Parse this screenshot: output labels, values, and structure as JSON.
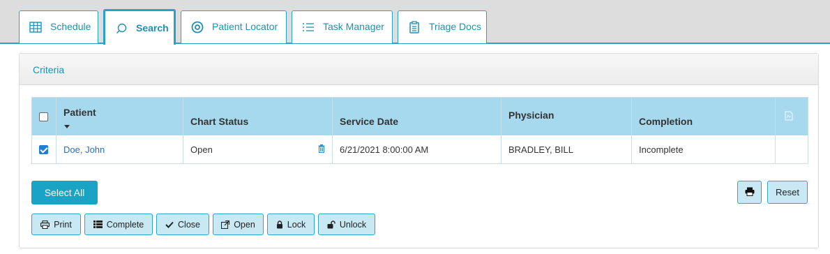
{
  "tabs": [
    {
      "label": "Schedule",
      "icon": "grid-icon",
      "active": false
    },
    {
      "label": "Search",
      "icon": "search-icon",
      "active": true
    },
    {
      "label": "Patient Locator",
      "icon": "target-icon",
      "active": false
    },
    {
      "label": "Task Manager",
      "icon": "list-icon",
      "active": false
    },
    {
      "label": "Triage Docs",
      "icon": "clipboard-icon",
      "active": false
    }
  ],
  "panel": {
    "title": "Criteria"
  },
  "table": {
    "columns": [
      "Patient",
      "Chart Status",
      "Service Date",
      "Physician",
      "Completion"
    ],
    "rows": [
      {
        "checked": true,
        "patient": "Doe, John",
        "chart_status": "Open",
        "service_date": "6/21/2021 8:00:00 AM",
        "physician": "BRADLEY, BILL",
        "completion": "Incomplete"
      }
    ]
  },
  "actions": {
    "select_all": "Select All",
    "reset": "Reset",
    "print": "Print",
    "complete": "Complete",
    "close": "Close",
    "open": "Open",
    "lock": "Lock",
    "unlock": "Unlock"
  },
  "colors": {
    "accent": "#29a3c3",
    "header_bg": "#a6d9ee",
    "button_bg": "#c8e9f4",
    "primary": "#1ba3c6"
  }
}
